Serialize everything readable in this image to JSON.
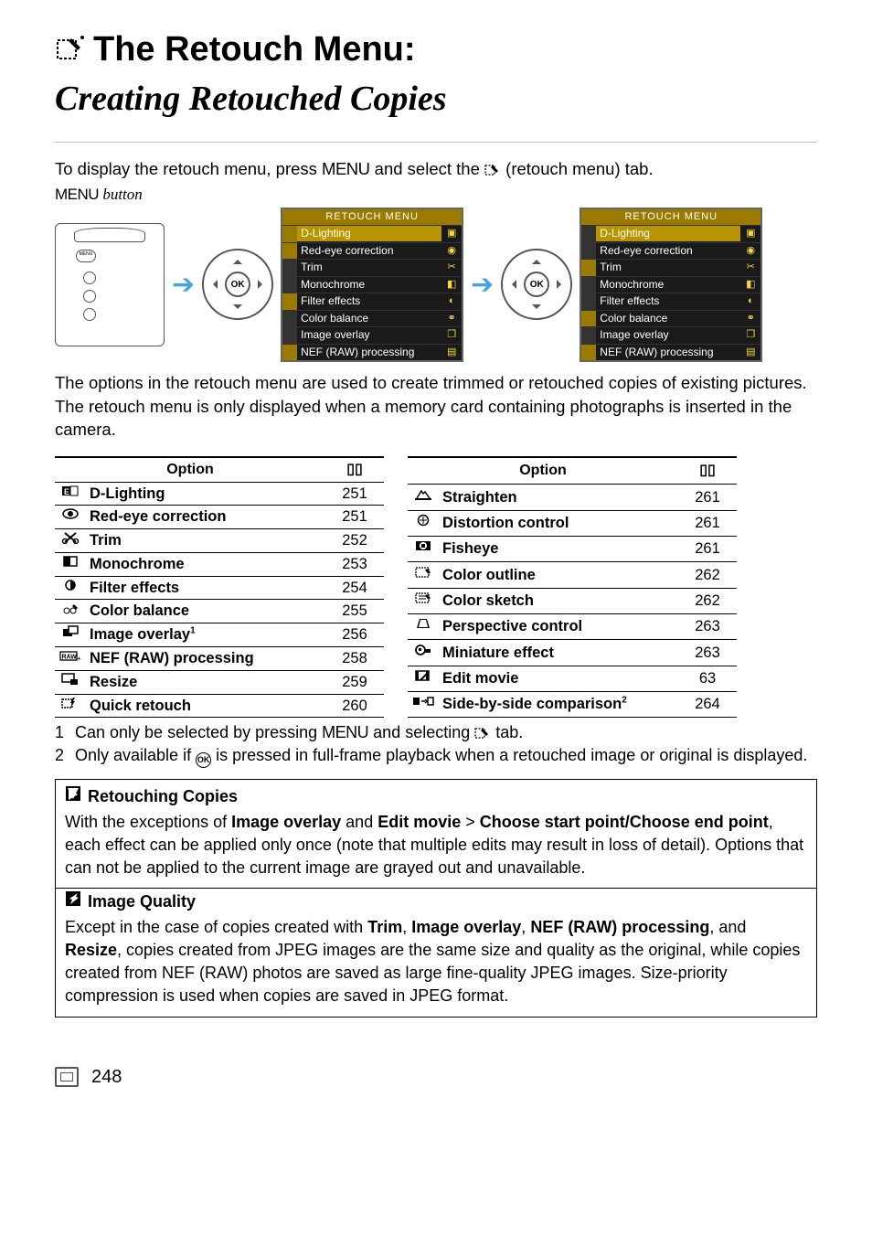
{
  "title": {
    "line1": "The Retouch Menu:",
    "line2": "Creating Retouched Copies"
  },
  "intro": "To display the retouch menu, press MENU and select the N (retouch menu) tab.",
  "menu_button_caption": "MENU button",
  "lcd": {
    "title": "RETOUCH MENU",
    "items": [
      "D-Lighting",
      "Red-eye correction",
      "Trim",
      "Monochrome",
      "Filter effects",
      "Color balance",
      "Image overlay",
      "NEF (RAW) processing"
    ]
  },
  "para2": "The options in the retouch menu are used to create trimmed or retouched copies of existing pictures.  The retouch menu is only displayed when a memory card containing photographs is inserted in the camera.",
  "table_headers": {
    "option": "Option",
    "page": "0"
  },
  "left_rows": [
    {
      "icon": "dlight",
      "label": "D-Lighting",
      "page": "251"
    },
    {
      "icon": "redeye",
      "label": "Red-eye correction",
      "page": "251"
    },
    {
      "icon": "trim",
      "label": "Trim",
      "page": "252"
    },
    {
      "icon": "mono",
      "label": "Monochrome",
      "page": "253"
    },
    {
      "icon": "filter",
      "label": "Filter effects",
      "page": "254"
    },
    {
      "icon": "colorbal",
      "label": "Color balance",
      "page": "255"
    },
    {
      "icon": "overlay",
      "label": "Image overlay",
      "sup": "1",
      "page": "256"
    },
    {
      "icon": "rawproc",
      "label": "NEF (RAW) processing",
      "page": "258"
    },
    {
      "icon": "resize",
      "label": "Resize",
      "page": "259"
    },
    {
      "icon": "quick",
      "label": "Quick retouch",
      "page": "260"
    }
  ],
  "right_rows": [
    {
      "icon": "straight",
      "label": "Straighten",
      "page": "261"
    },
    {
      "icon": "distort",
      "label": "Distortion control",
      "page": "261"
    },
    {
      "icon": "fisheye",
      "label": "Fisheye",
      "page": "261"
    },
    {
      "icon": "outline",
      "label": "Color outline",
      "page": "262"
    },
    {
      "icon": "sketch",
      "label": "Color sketch",
      "page": "262"
    },
    {
      "icon": "persp",
      "label": "Perspective control",
      "page": "263"
    },
    {
      "icon": "mini",
      "label": "Miniature effect",
      "page": "263"
    },
    {
      "icon": "edmov",
      "label": "Edit movie",
      "page": "63"
    },
    {
      "icon": "sbs",
      "label": "Side-by-side comparison",
      "sup": "2",
      "page": "264"
    }
  ],
  "footnotes": [
    "Can only be selected by pressing MENU and selecting N tab.",
    "Only available if J is pressed in full-frame playback when a retouched image or original is displayed."
  ],
  "note_retouch": {
    "title": "Retouching Copies",
    "body_prefix": "With the exceptions of ",
    "bold1": "Image overlay",
    "mid1": " and ",
    "bold2": "Edit movie",
    "mid2": " > ",
    "bold3": "Choose start point/Choose end point",
    "body_suffix": ", each effect can be applied only once (note that multiple edits may result in loss of detail).  Options that can not be applied to the current image are grayed out and unavailable."
  },
  "note_iq": {
    "title": "Image Quality",
    "prefix": "Except in the case of copies created with ",
    "b1": "Trim",
    "c1": ", ",
    "b2": "Image overlay",
    "c2": ", ",
    "b3": "NEF (RAW) processing",
    "c3": ", and ",
    "b4": "Resize",
    "suffix": ", copies created from JPEG images are the same size and quality as the original, while copies created from NEF (RAW) photos are saved as large fine-quality JPEG images.  Size-priority compression is used when copies are saved in JPEG format."
  },
  "page_number": "248"
}
